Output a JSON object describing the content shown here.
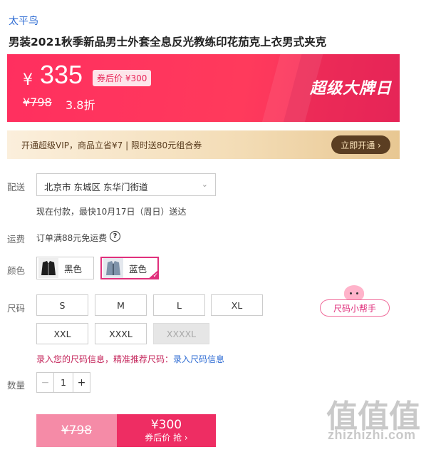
{
  "brand": "太平鸟",
  "product_title": "男装2021秋季新品男士外套全息反光教练印花茄克上衣男式夹克",
  "price": {
    "currency": "¥",
    "current": "335",
    "after_coupon_badge": "券后价 ¥300",
    "original": "¥798",
    "discount": "3.8折",
    "promo_title": "超级大牌日"
  },
  "vip": {
    "text": "开通超级VIP，商品立省¥7 | 限时送80元组合券",
    "button": "立即开通 ›"
  },
  "delivery": {
    "label": "配送",
    "address": "北京市 东城区 东华门街道",
    "note": "现在付款，最快10月17日（周日）送达"
  },
  "freight": {
    "label": "运费",
    "text": "订单满88元免运费",
    "help_icon": "?"
  },
  "color": {
    "label": "颜色",
    "options": [
      {
        "name": "黑色",
        "selected": false
      },
      {
        "name": "蓝色",
        "selected": true
      }
    ]
  },
  "size": {
    "label": "尺码",
    "options": [
      "S",
      "M",
      "L",
      "XL",
      "XXL",
      "XXXL",
      "XXXXL"
    ],
    "disabled": [
      "XXXXL"
    ],
    "helper": "尺码小帮手",
    "note_prefix": "录入您的尺码信息，精准推荐尺码：",
    "note_link": "录入尺码信息"
  },
  "quantity": {
    "label": "数量",
    "value": "1",
    "minus": "−",
    "plus": "+"
  },
  "buy_button": {
    "original": "¥798",
    "price": "¥300",
    "sub": "券后价 抢 ›"
  },
  "watermark": {
    "glyphs": "值值值",
    "text": "zhizhizhi.com"
  }
}
